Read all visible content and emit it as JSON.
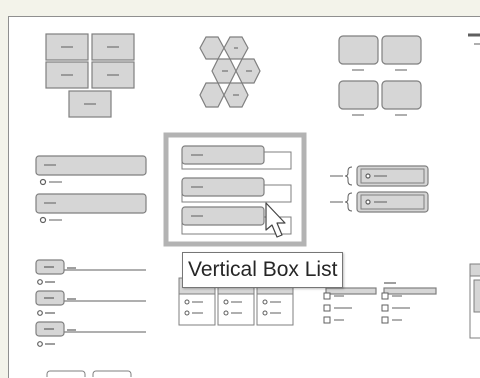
{
  "gallery": {
    "tooltip": "Vertical Box List",
    "selected_item": "Vertical Box List"
  },
  "colors": {
    "shape_fill": "#d6d6d6",
    "shape_stroke": "#7f7f7f",
    "selection": "#b3b3b3",
    "text_gray": "#5f5f5f"
  }
}
